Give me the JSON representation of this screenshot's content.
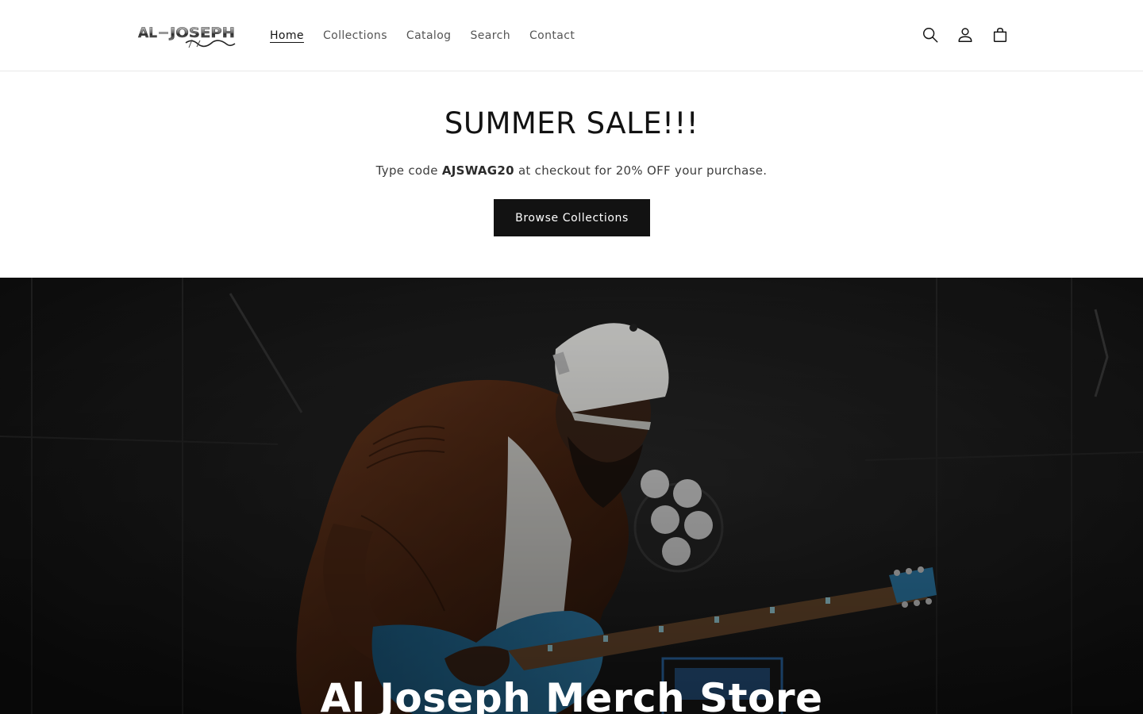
{
  "header": {
    "logo_text": "AL JOSEPH Merch",
    "nav": [
      {
        "label": "Home",
        "active": true
      },
      {
        "label": "Collections",
        "active": false
      },
      {
        "label": "Catalog",
        "active": false
      },
      {
        "label": "Search",
        "active": false
      },
      {
        "label": "Contact",
        "active": false
      }
    ],
    "icons": [
      "search-icon",
      "account-icon",
      "cart-icon"
    ]
  },
  "promo": {
    "title": "SUMMER SALE!!!",
    "text_before": "Type code ",
    "code": "AJSWAG20",
    "text_after": " at checkout for 20% OFF your purchase.",
    "button_label": "Browse Collections"
  },
  "hero": {
    "title": "Al Joseph Merch Store"
  },
  "colors": {
    "button_bg": "#121212",
    "text_primary": "#121212",
    "text_muted": "#555555",
    "hero_overlay": "#121212"
  }
}
